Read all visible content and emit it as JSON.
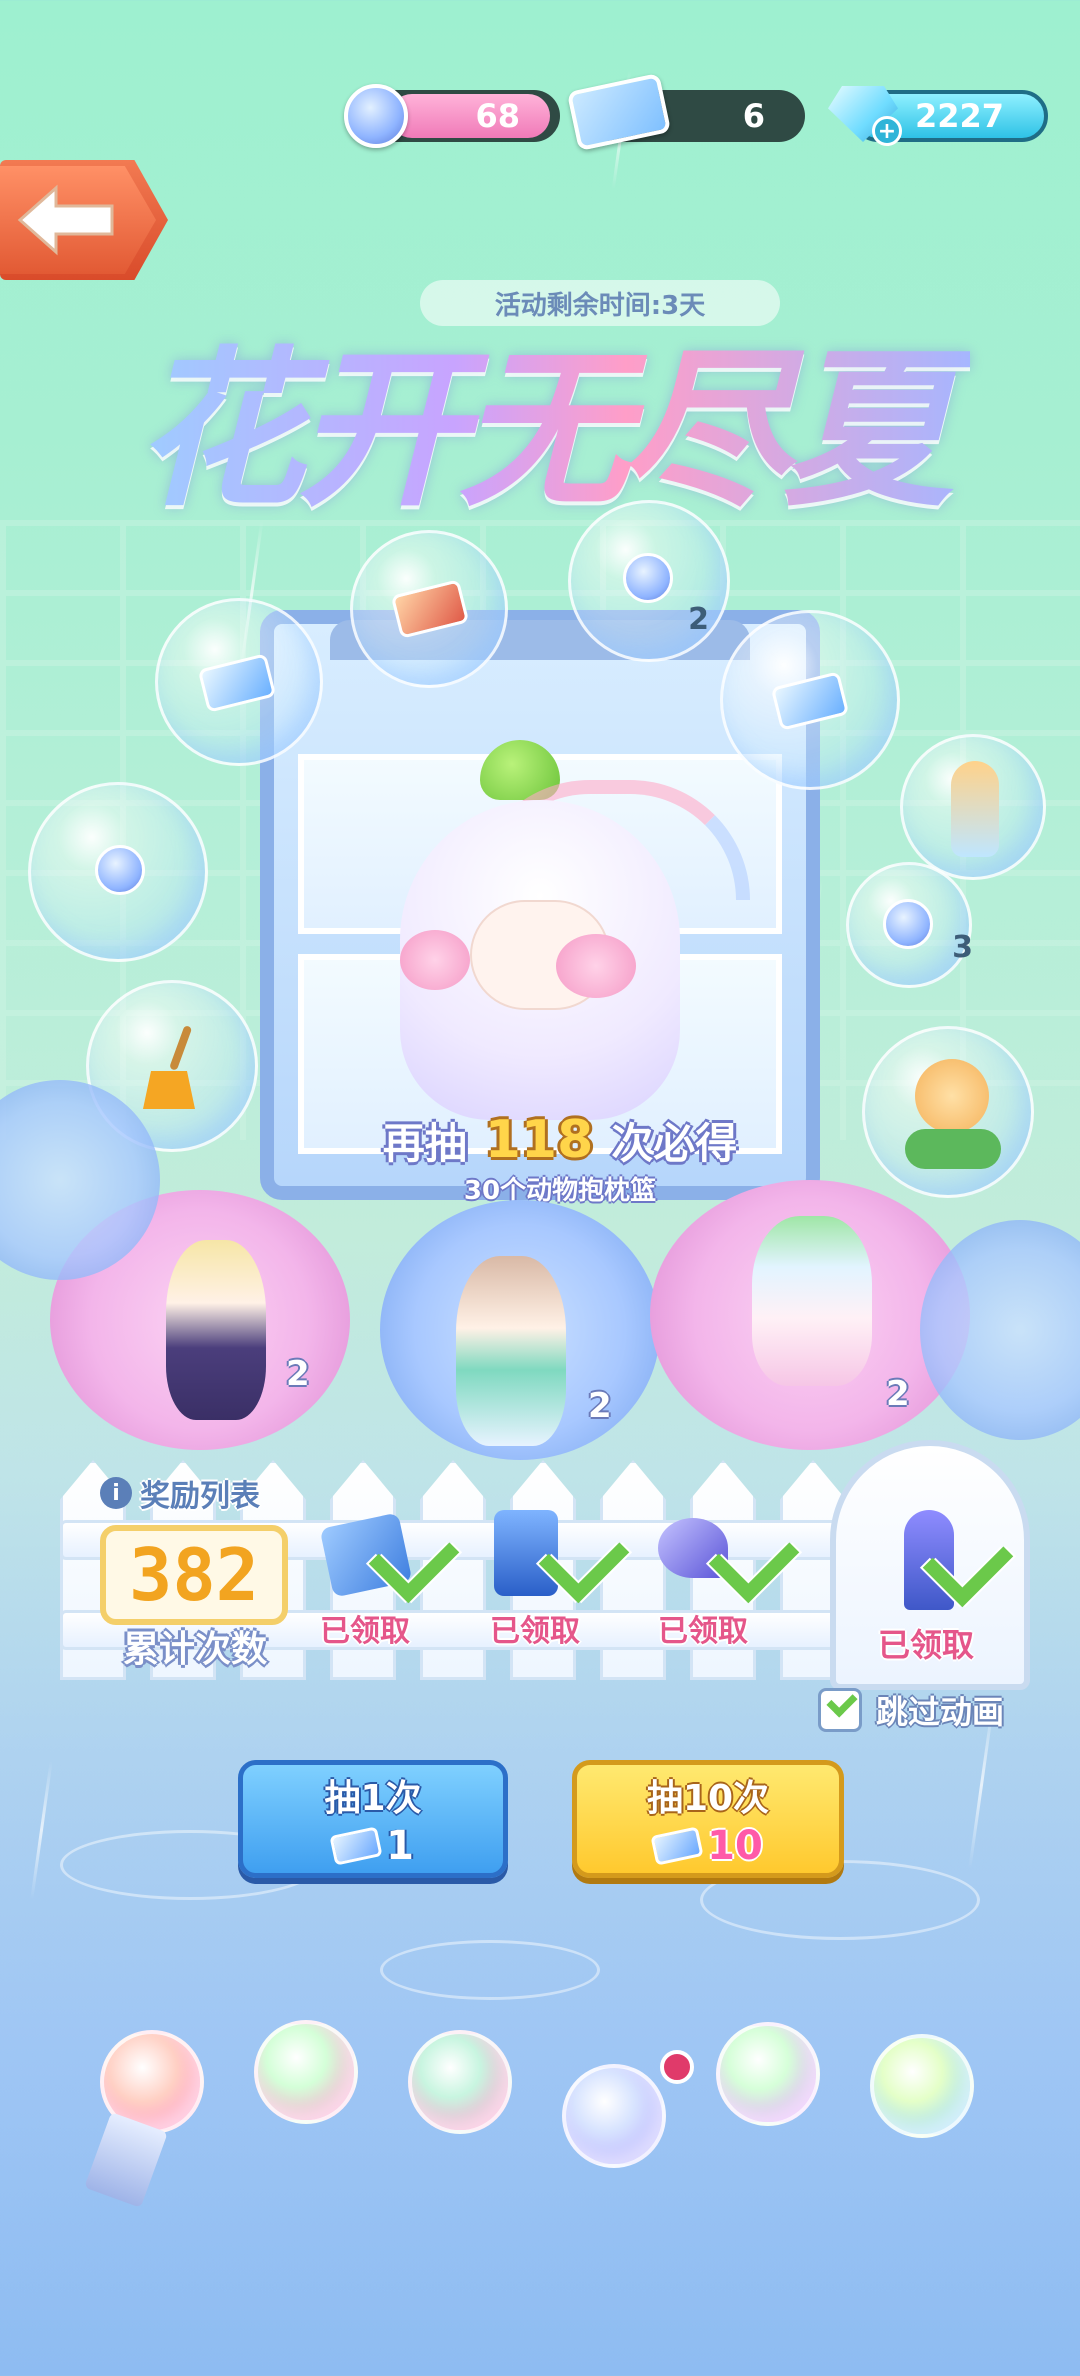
{
  "currencies": {
    "flower_orbs": "68",
    "tickets": "6",
    "diamonds": "2227"
  },
  "event": {
    "timer_text": "活动剩余时间:3天",
    "title": "花开无尽夏"
  },
  "bubbles": [
    {
      "icon": "ticket-icon",
      "count": ""
    },
    {
      "icon": "rail-ticket-icon",
      "count": ""
    },
    {
      "icon": "flower-orb-icon",
      "count": "2"
    },
    {
      "icon": "plane-ticket-icon",
      "count": ""
    },
    {
      "icon": "flower-orb-icon",
      "count": ""
    },
    {
      "icon": "flower-vase-icon",
      "count": ""
    },
    {
      "icon": "flower-orb-icon",
      "count": "3"
    },
    {
      "icon": "broom-icon",
      "count": ""
    },
    {
      "icon": "yellow-flower-icon",
      "count": ""
    }
  ],
  "pity": {
    "prefix": "再抽",
    "remaining": "118",
    "suffix": "次必得",
    "prize": "30个动物抱枕篮"
  },
  "featured": {
    "left_count": "2",
    "center_count": "2",
    "right_count": "2"
  },
  "rewards": {
    "list_label": "奖励列表",
    "total_draws": "382",
    "total_label": "累计次数",
    "items": [
      {
        "icon": "plane-ticket-icon",
        "status": "已领取"
      },
      {
        "icon": "blue-cabinet-icon",
        "status": "已领取"
      },
      {
        "icon": "blue-flower-icon",
        "status": "已领取"
      },
      {
        "icon": "iris-flower-icon",
        "status": "已领取"
      }
    ]
  },
  "skip_animation": "跳过动画",
  "draw_buttons": {
    "single_label": "抽1次",
    "single_cost": "1",
    "ten_label": "抽10次",
    "ten_cost": "10"
  },
  "colors": {
    "bg_top": "#9ef0d0",
    "bg_bottom": "#8ebcf2",
    "pity_number": "#ffd54a",
    "claimed_text": "#e5568a",
    "check_green": "#6bc94a"
  }
}
